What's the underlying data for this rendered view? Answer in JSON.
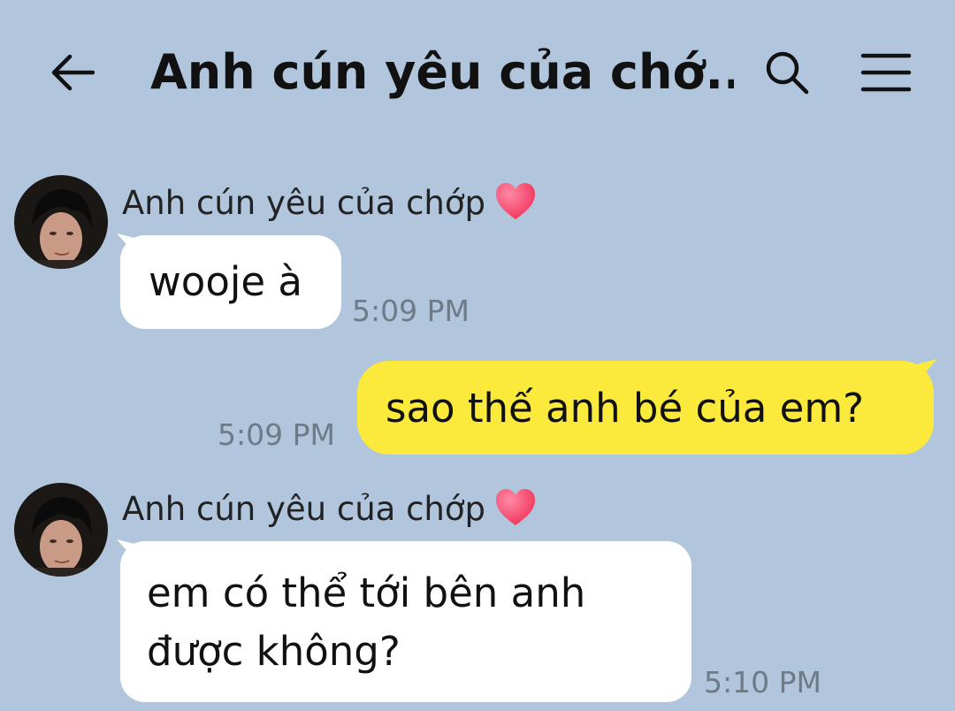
{
  "header": {
    "back_icon": "arrow-left-icon",
    "title": "Anh cún yêu của chớ...",
    "search_icon": "search-icon",
    "menu_icon": "hamburger-menu-icon"
  },
  "theme": {
    "chat_background": "#b1c6dd",
    "incoming_bubble": "#ffffff",
    "outgoing_bubble": "#fbe93c",
    "heart_color": "#f2325a",
    "timestamp_color": "#6d7a88"
  },
  "messages": [
    {
      "direction": "incoming",
      "sender": "Anh cún yêu của chớp",
      "sender_badge": "heart-icon",
      "text": "wooje à",
      "time": "5:09 PM"
    },
    {
      "direction": "outgoing",
      "text": "sao thế anh bé của em?",
      "time": "5:09 PM"
    },
    {
      "direction": "incoming",
      "sender": "Anh cún yêu của chớp",
      "sender_badge": "heart-icon",
      "text_lines": [
        "em có thể tới bên anh",
        "được không?"
      ],
      "time": "5:10 PM"
    }
  ]
}
